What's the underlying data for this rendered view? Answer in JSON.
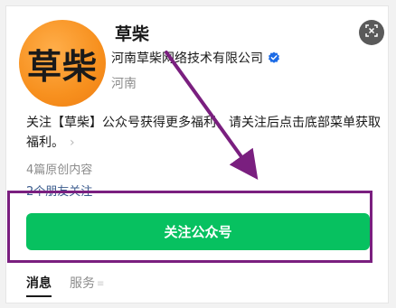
{
  "profile": {
    "avatar_text": "草柴",
    "name": "草柴",
    "company": "河南草柴网络技术有限公司",
    "region": "河南"
  },
  "description": {
    "text": "关注【草柴】公众号获得更多福利，请关注后点击底部菜单获取福利。",
    "chevron": "›"
  },
  "stats": {
    "original_count": "4篇原创内容",
    "friends_follow": "2个朋友关注"
  },
  "actions": {
    "follow_label": "关注公众号"
  },
  "tabs": [
    {
      "label": "消息"
    },
    {
      "label": "服务"
    }
  ],
  "colors": {
    "accent_green": "#07c160",
    "highlight": "#7a1f7f",
    "verified_blue": "#1c6be6",
    "link_blue": "#3a5a8c"
  },
  "icons": {
    "verified": "verified-badge-icon",
    "close": "scan-close-icon",
    "tab_menu": "menu-lines-icon",
    "desc_more": "chevron-right-icon"
  }
}
